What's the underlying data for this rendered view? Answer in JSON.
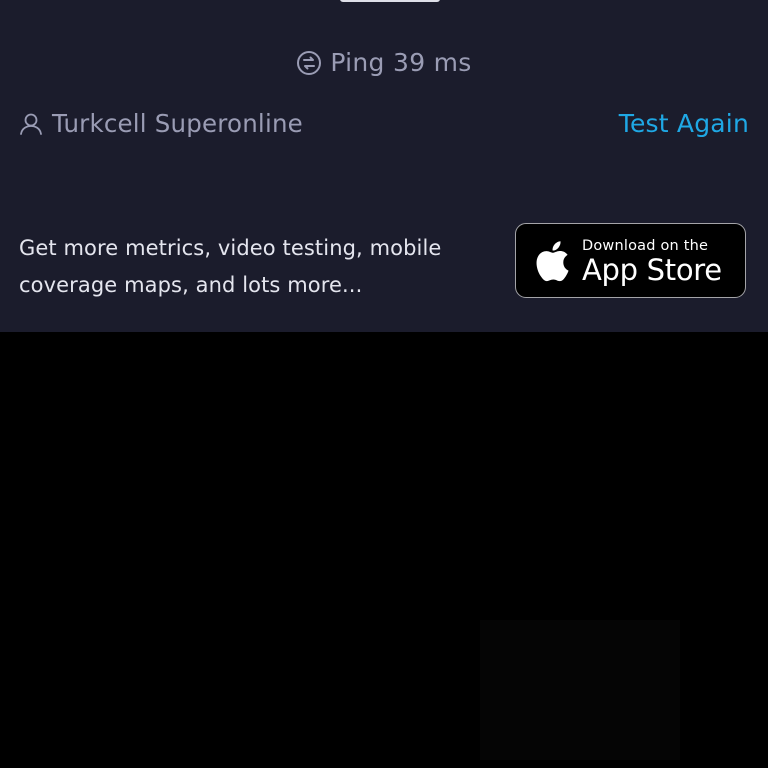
{
  "ping": {
    "label": "Ping",
    "value": "39",
    "unit": "ms",
    "icon": "ping-icon"
  },
  "provider": {
    "name": "Turkcell Superonline",
    "icon": "user-icon"
  },
  "actions": {
    "test_again": "Test Again"
  },
  "promo": {
    "text": "Get more metrics, video testing, mobile coverage maps, and lots more...",
    "store_small": "Download on the",
    "store_big": "App Store",
    "store_icon": "apple-icon"
  },
  "colors": {
    "panel": "#1b1c2c",
    "muted_text": "#9a9cb4",
    "link": "#1fa8e5",
    "background": "#000000"
  }
}
